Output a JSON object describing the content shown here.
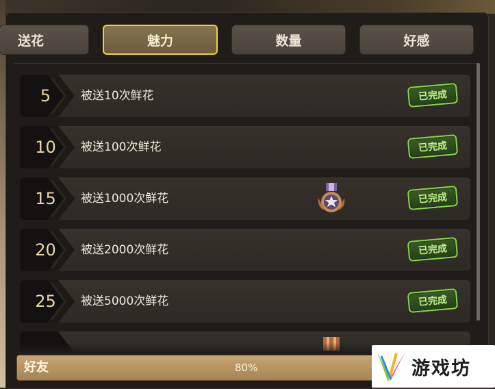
{
  "tabs": [
    {
      "label": "送花",
      "active": false
    },
    {
      "label": "魅力",
      "active": true
    },
    {
      "label": "数量",
      "active": false
    },
    {
      "label": "好感",
      "active": false
    }
  ],
  "achievements": [
    {
      "level": "5",
      "description": "被送10次鲜花",
      "status": "已完成",
      "has_medal": false
    },
    {
      "level": "10",
      "description": "被送100次鲜花",
      "status": "已完成",
      "has_medal": false
    },
    {
      "level": "15",
      "description": "被送1000次鲜花",
      "status": "已完成",
      "has_medal": true
    },
    {
      "level": "20",
      "description": "被送2000次鲜花",
      "status": "已完成",
      "has_medal": false
    },
    {
      "level": "25",
      "description": "被送5000次鲜花",
      "status": "已完成",
      "has_medal": false
    }
  ],
  "footer": {
    "label": "好友",
    "percent_text": "80%",
    "progress": 0.8
  },
  "watermark": {
    "text": "游戏坊"
  },
  "colors": {
    "active_tab_border": "#e8d24a",
    "done_border": "#86d54a",
    "done_text": "#bdf08a",
    "level_text": "#e9d7a8"
  }
}
